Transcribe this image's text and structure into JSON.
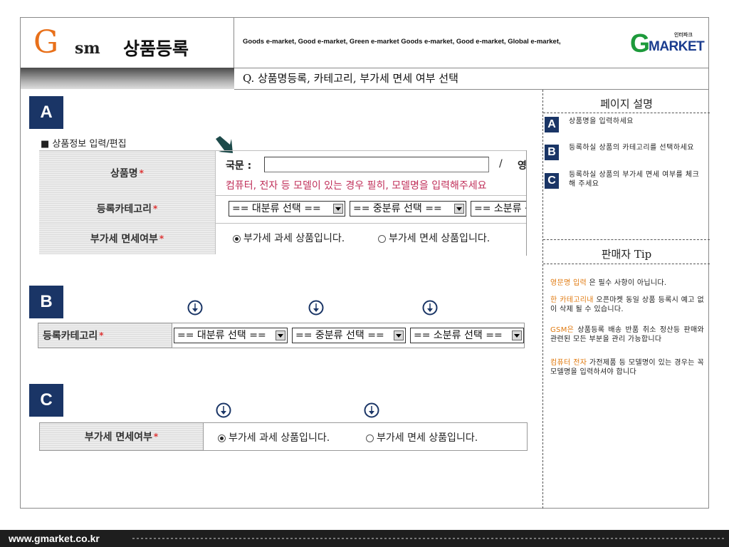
{
  "header": {
    "logo_g": "G",
    "logo_sm": "sm",
    "title": "상품등록",
    "slogan": "Goods e-market, Good e-market, Green e-market Goods e-market, Good e-market, Global e-market,",
    "gmarket_logo_g": "G",
    "gmarket_logo_text": "MARKET",
    "gmarket_logo_small": "인터파크",
    "question": "Q. 상품명등록, 카테고리, 부가세 면세 여부 선택"
  },
  "right_panel": {
    "description_title": "페이지 설명",
    "items": [
      {
        "badge": "A",
        "text": "상품명을 입력하세요"
      },
      {
        "badge": "B",
        "text": "등록하실 상품의 카테고리를 선택하세요"
      },
      {
        "badge": "C",
        "text": "등록하실 상품의 부가세 면세 여부를 체크해 주세요"
      }
    ],
    "tip_title": "판매자 Tip",
    "tips": [
      {
        "highlight": "영문명 입력",
        "text": " 은 필수 사항이 아닙니다."
      },
      {
        "highlight": "한 카테고리내",
        "text": " 오픈마켓 동일 상품 등록시 예고 없이 삭제 될 수 있습니다."
      },
      {
        "highlight": "GSM은",
        "text": " 상품등록 배송 반품 취소 정산등 판매와 관련된 모든 부분을 관리 가능합니다"
      },
      {
        "highlight": "컴퓨터 전자",
        "text": " 가전제품 등 모델명이 있는 경우는 꼭 모델명을 입력하셔야 합니다"
      }
    ]
  },
  "sections": {
    "a": {
      "badge": "A",
      "form_title": "■ 상품정보 입력/편집",
      "product_name_label": "상품명",
      "domestic_label": "국문 :",
      "slash": "/",
      "english_label": "영",
      "name_hint": "컴퓨터, 전자 등 모델이 있는 경우 필히, 모델명을 입력해주세요",
      "category_label": "등록카테고리",
      "category_selects": [
        "== 대분류 선택 ==",
        "== 중분류 선택 ==",
        "== 소분류 선택 =="
      ],
      "vat_label": "부가세 면세여부",
      "vat_options": [
        "부가세 과세 상품입니다.",
        "부가세 면세 상품입니다."
      ],
      "vat_selected": 0
    },
    "b": {
      "badge": "B",
      "category_label": "등록카테고리",
      "category_selects": [
        "== 대분류 선택 ==",
        "== 중분류 선택 ==",
        "== 소분류 선택 =="
      ]
    },
    "c": {
      "badge": "C",
      "vat_label": "부가세 면세여부",
      "vat_options": [
        "부가세 과세 상품입니다.",
        "부가세 면세 상품입니다."
      ],
      "vat_selected": 0
    }
  },
  "footer": {
    "url": "www.gmarket.co.kr"
  },
  "colors": {
    "badge": "#1a3566",
    "orange": "#e8701a",
    "hint_red": "#c0305a",
    "gmarket_green": "#1d9a3b",
    "gmarket_blue": "#1a3c8e"
  }
}
